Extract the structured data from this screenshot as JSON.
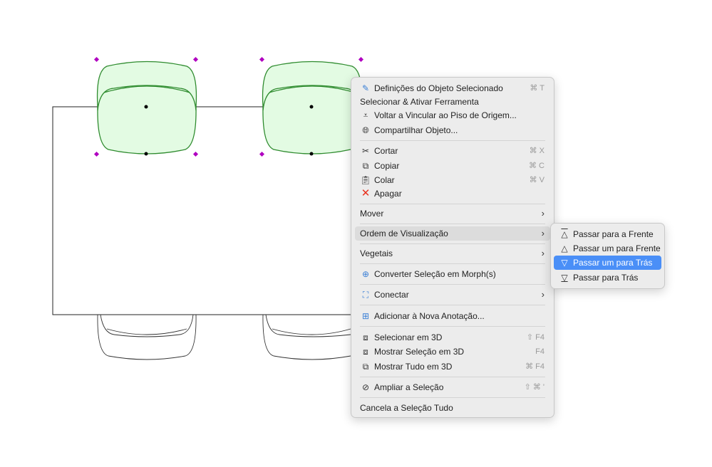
{
  "context_menu": {
    "items": [
      {
        "label": "Definições do Objeto Selecionado",
        "shortcut": "⌘ T",
        "icon": "object-settings-icon"
      },
      {
        "label": "Selecionar & Ativar Ferramenta"
      },
      {
        "label": "Voltar a Vincular ao Piso de Origem...",
        "icon": "relink-floor-icon"
      },
      {
        "label": "Compartilhar Objeto...",
        "icon": "share-globe-icon"
      },
      {
        "label": "Cortar",
        "shortcut": "⌘ X",
        "icon": "scissors-icon"
      },
      {
        "label": "Copiar",
        "shortcut": "⌘ C",
        "icon": "copy-icon"
      },
      {
        "label": "Colar",
        "shortcut": "⌘ V",
        "icon": "paste-icon"
      },
      {
        "label": "Apagar",
        "icon": "delete-x-icon"
      },
      {
        "label": "Mover"
      },
      {
        "label": "Ordem de Visualização"
      },
      {
        "label": "Vegetais"
      },
      {
        "label": "Converter Seleção em Morph(s)",
        "icon": "morph-icon"
      },
      {
        "label": "Conectar",
        "icon": "connect-icon"
      },
      {
        "label": "Adicionar à Nova Anotação...",
        "icon": "annotation-icon"
      },
      {
        "label": "Selecionar em 3D",
        "shortcut": "⇧ F4",
        "icon": "select-3d-icon"
      },
      {
        "label": "Mostrar Seleção em 3D",
        "shortcut": "F4",
        "icon": "show-selection-3d-icon"
      },
      {
        "label": "Mostrar Tudo em 3D",
        "shortcut": "⌘ F4",
        "icon": "show-all-3d-icon"
      },
      {
        "label": "Ampliar a Seleção",
        "shortcut": "⇧ ⌘ '",
        "icon": "zoom-selection-icon"
      },
      {
        "label": "Cancela a Seleção Tudo"
      }
    ]
  },
  "submenu": {
    "items": [
      {
        "label": "Passar para a Frente",
        "icon": "bring-to-front-icon"
      },
      {
        "label": "Passar um para Frente",
        "icon": "bring-forward-icon"
      },
      {
        "label": "Passar um para Trás",
        "icon": "send-backward-icon",
        "highlighted": true
      },
      {
        "label": "Passar para Trás",
        "icon": "send-to-back-icon"
      }
    ]
  },
  "colors": {
    "selection_fill": "#e3fbe3",
    "selection_stroke": "#2e8b2e",
    "handle": "#b000c0",
    "highlight": "#4a8ff7",
    "delete": "#e8321e"
  }
}
